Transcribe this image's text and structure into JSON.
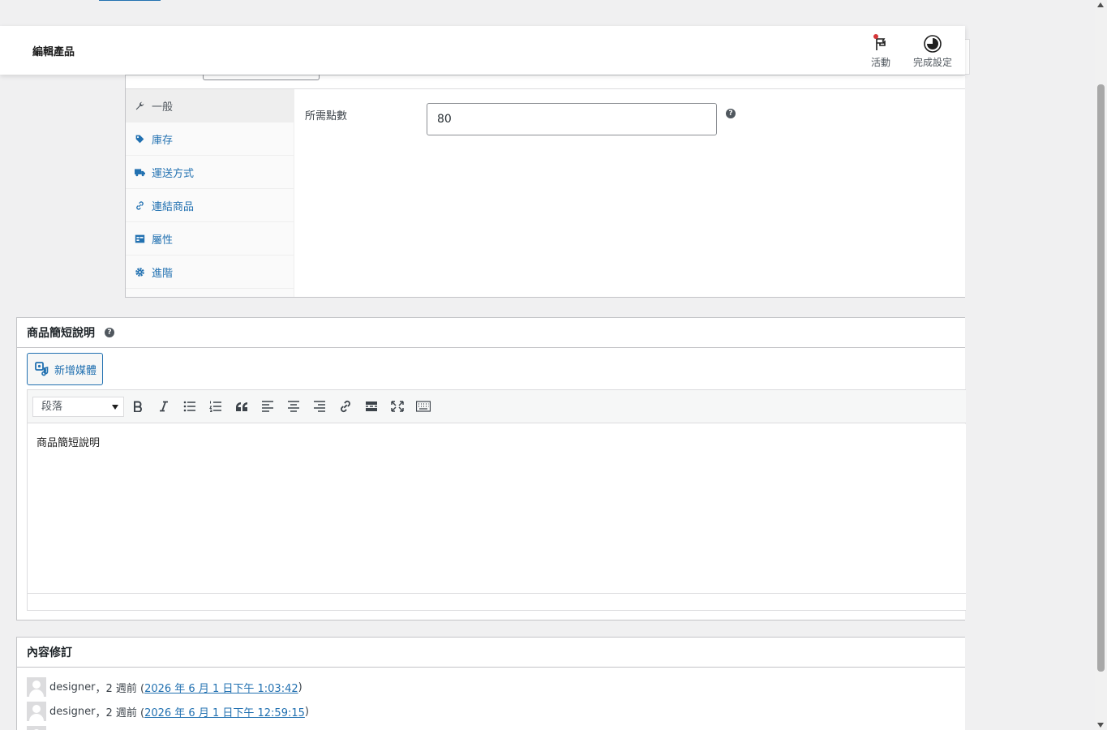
{
  "header": {
    "title": "編輯產品",
    "activity_label": "活動",
    "setup_label": "完成設定"
  },
  "product_data": {
    "tabs": [
      {
        "label": "一般",
        "icon": "wrench-icon"
      },
      {
        "label": "庫存",
        "icon": "tag-icon"
      },
      {
        "label": "運送方式",
        "icon": "truck-icon"
      },
      {
        "label": "連結商品",
        "icon": "link-icon"
      },
      {
        "label": "屬性",
        "icon": "list-table-icon"
      },
      {
        "label": "進階",
        "icon": "gear-icon"
      }
    ],
    "field_label": "所需點數",
    "field_value": "80"
  },
  "short_description": {
    "title": "商品簡短說明",
    "add_media_label": "新增媒體",
    "format_select": "段落",
    "content": "商品簡短說明"
  },
  "revisions": {
    "title": "內容修訂",
    "items": [
      {
        "author": "designer",
        "ago": "，2 週前 (",
        "link": "2026 年 6 月 1 日下午 1:03:42",
        "close": ")"
      },
      {
        "author": "designer",
        "ago": "，2 週前 (",
        "link": "2026 年 6 月 1 日下午 12:59:15",
        "close": ")"
      }
    ]
  },
  "colors": {
    "accent": "#2271b1",
    "notification": "#d63638"
  }
}
